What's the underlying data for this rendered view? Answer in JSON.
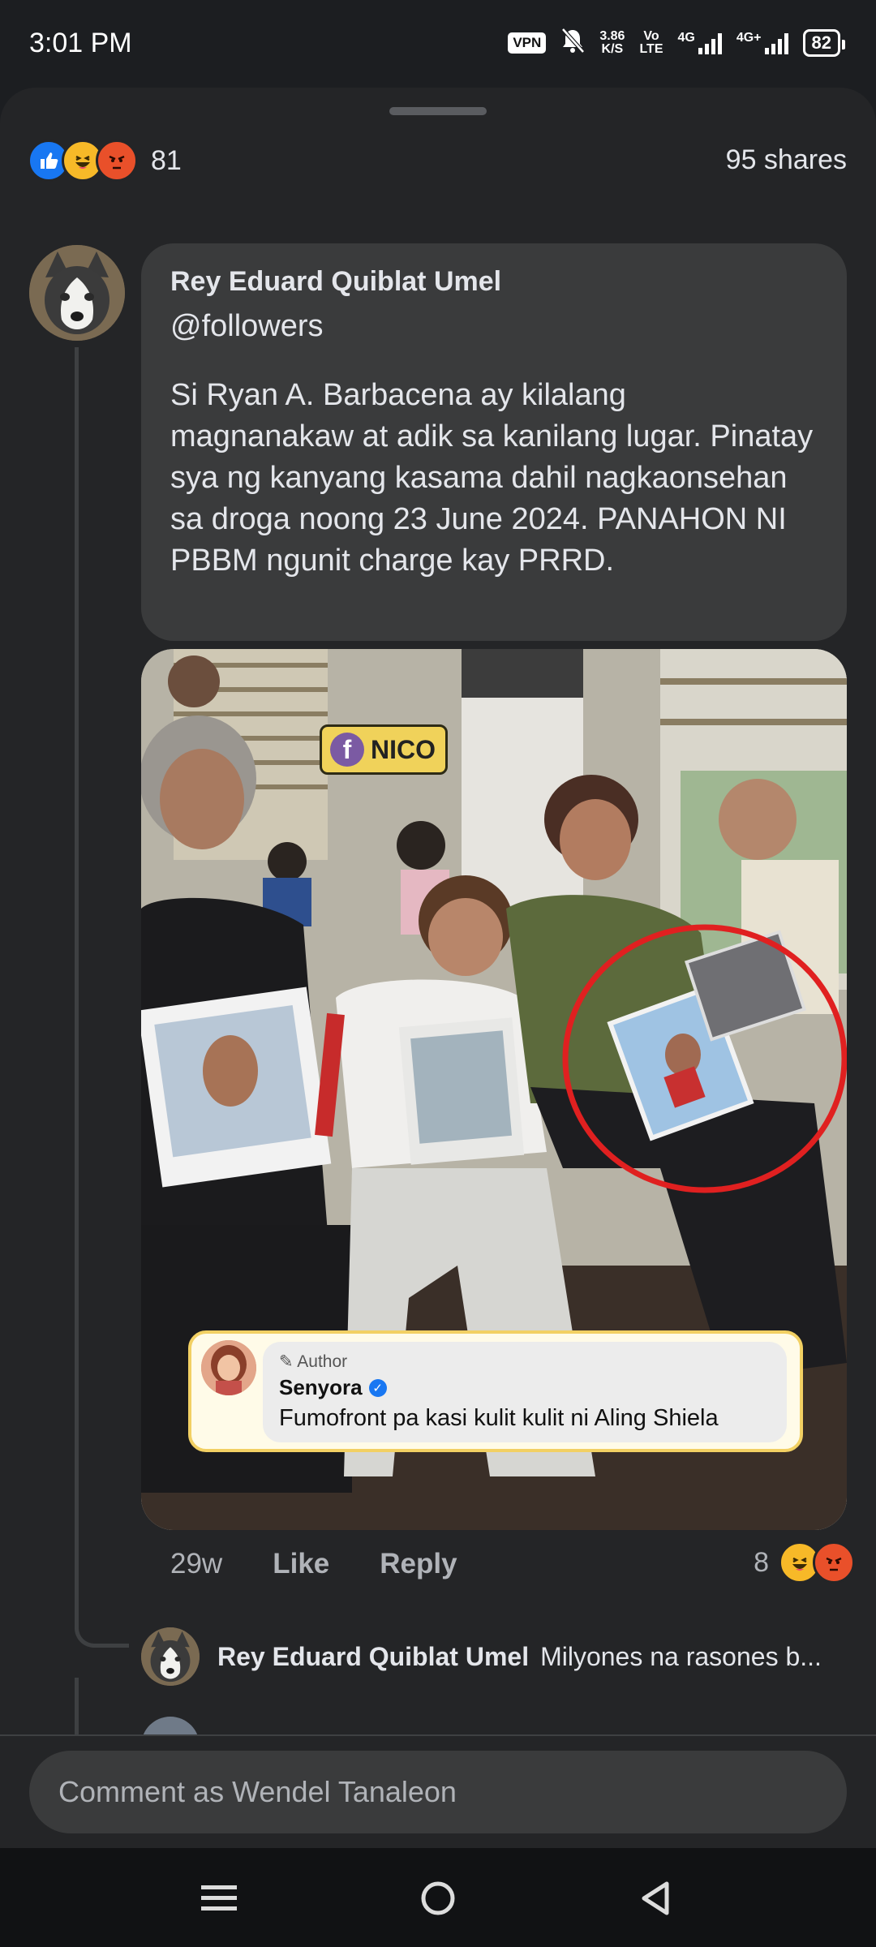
{
  "status_bar": {
    "time": "3:01 PM",
    "vpn": "VPN",
    "speed_value": "3.86",
    "speed_unit": "K/S",
    "volte_top": "Vo",
    "volte_bottom": "LTE",
    "net1": "4G",
    "net2": "4G+",
    "battery": "82",
    "icons": [
      "vpn-icon",
      "mute-icon",
      "signal-icon",
      "battery-icon"
    ]
  },
  "post_stats": {
    "reaction_icons": [
      "like",
      "haha",
      "angry"
    ],
    "reaction_count": "81",
    "shares": "95 shares"
  },
  "comment": {
    "author": "Rey Eduard Quiblat Umel",
    "mention": "@followers",
    "text": "Si Ryan A. Barbacena ay kilalang magnanakaw at adik sa kanilang lugar. Pinatay sya ng kanyang kasama dahil nagkaonsehan sa droga noong 23 June 2024. PANAHON NI PBBM ngunit charge kay PRRD.",
    "image": {
      "watermark": "NICO",
      "watermark_icon": "f",
      "embedded_comment": {
        "tag": "Author",
        "name": "Senyora",
        "text": "Fumofront pa kasi kulit kulit ni Aling Shiela"
      }
    },
    "time": "29w",
    "like_label": "Like",
    "reply_label": "Reply",
    "reaction_count": "8",
    "reaction_icons": [
      "haha",
      "angry"
    ]
  },
  "reply": {
    "author": "Rey Eduard Quiblat Umel",
    "text": "Milyones na rasones b..."
  },
  "composer": {
    "placeholder": "Comment as Wendel Tanaleon"
  },
  "colors": {
    "background": "#1c1e21",
    "sheet": "#242527",
    "bubble": "#3a3b3c",
    "like_blue": "#1877f2",
    "text_primary": "#e4e6eb",
    "text_secondary": "#b0b3b8",
    "highlight_circle": "#e02020"
  }
}
